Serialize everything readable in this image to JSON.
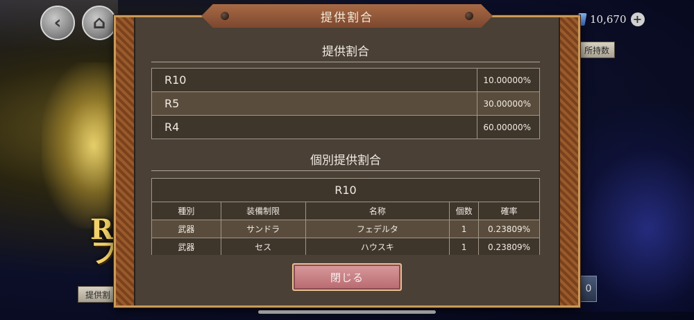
{
  "background": {
    "banner_text_line1": "R",
    "banner_text_line2": "フ",
    "rates_button_label": "提供割",
    "owned_button_label": "所持数",
    "right_button_label": "0"
  },
  "header": {
    "currency_amount": "10,670"
  },
  "modal": {
    "title": "提供割合",
    "rarity_section_title": "提供割合",
    "rarity_rates": [
      {
        "rarity": "R10",
        "rate": "10.00000%"
      },
      {
        "rarity": "R5",
        "rate": "30.00000%"
      },
      {
        "rarity": "R4",
        "rate": "60.00000%"
      }
    ],
    "item_section_title": "個別提供割合",
    "item_group_title": "R10",
    "item_columns": [
      "種別",
      "装備制限",
      "名称",
      "個数",
      "確率"
    ],
    "items": [
      {
        "type": "武器",
        "restriction": "サンドラ",
        "name": "フェデルタ",
        "count": "1",
        "rate": "0.23809%"
      },
      {
        "type": "武器",
        "restriction": "セス",
        "name": "ハウスキ",
        "count": "1",
        "rate": "0.23809%"
      }
    ],
    "close_label": "閉じる"
  }
}
